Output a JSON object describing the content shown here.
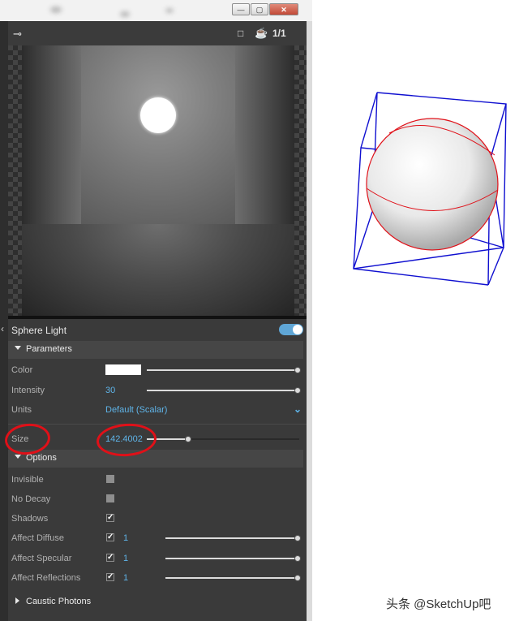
{
  "window": {
    "minimize": "—",
    "maximize": "▢",
    "close": "✕"
  },
  "toolbar": {
    "ratio_label": "1/1"
  },
  "panel": {
    "title": "Sphere Light",
    "enabled": true,
    "parameters": {
      "header": "Parameters",
      "color_label": "Color",
      "color_value": "#ffffff",
      "intensity_label": "Intensity",
      "intensity_value": "30",
      "units_label": "Units",
      "units_value": "Default (Scalar)",
      "size_label": "Size",
      "size_value": "142.4002",
      "size_level": 0.25
    },
    "options": {
      "header": "Options",
      "invisible_label": "Invisible",
      "invisible_checked": false,
      "nodecay_label": "No Decay",
      "nodecay_checked": false,
      "shadows_label": "Shadows",
      "shadows_checked": true,
      "diffuse_label": "Affect Diffuse",
      "diffuse_value": "1",
      "specular_label": "Affect Specular",
      "specular_value": "1",
      "reflections_label": "Affect Reflections",
      "reflections_value": "1"
    },
    "caustic_header": "Caustic Photons"
  },
  "watermark": "头条 @SketchUp吧",
  "colors": {
    "accent": "#5fb4e8",
    "highlight": "#e01018",
    "bbox": "#1010d0"
  }
}
